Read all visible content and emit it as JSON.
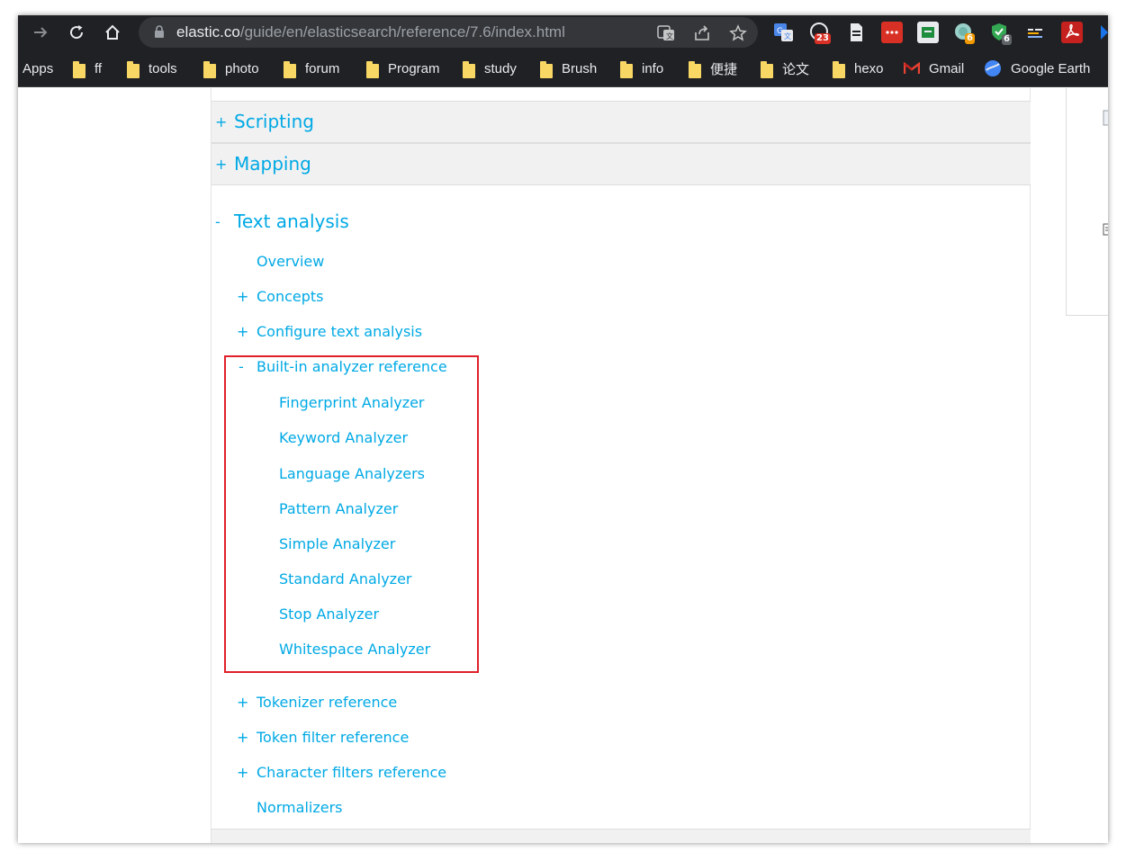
{
  "browser": {
    "url_host": "elastic.co",
    "url_path": "/guide/en/elasticsearch/reference/7.6/index.html",
    "badges": {
      "ext_timer": "23",
      "ext_globe": "6",
      "ext_shield": "6"
    }
  },
  "bookmarks": [
    {
      "label": "Apps"
    },
    {
      "label": "ff"
    },
    {
      "label": "tools"
    },
    {
      "label": "photo"
    },
    {
      "label": "forum"
    },
    {
      "label": "Program"
    },
    {
      "label": "study"
    },
    {
      "label": "Brush"
    },
    {
      "label": "info"
    },
    {
      "label": "便捷"
    },
    {
      "label": "论文"
    },
    {
      "label": "hexo"
    },
    {
      "label": "Gmail"
    },
    {
      "label": "Google Earth"
    }
  ],
  "nav": {
    "sections": [
      {
        "toggle": "+",
        "label": "Scripting"
      },
      {
        "toggle": "+",
        "label": "Mapping"
      },
      {
        "toggle": "-",
        "label": "Text analysis"
      }
    ],
    "text_analysis_items": [
      {
        "toggle": "",
        "label": "Overview"
      },
      {
        "toggle": "+",
        "label": "Concepts"
      },
      {
        "toggle": "+",
        "label": "Configure text analysis"
      },
      {
        "toggle": "-",
        "label": "Built-in analyzer reference"
      }
    ],
    "analyzers": [
      "Fingerprint Analyzer",
      "Keyword Analyzer",
      "Language Analyzers",
      "Pattern Analyzer",
      "Simple Analyzer",
      "Standard Analyzer",
      "Stop Analyzer",
      "Whitespace Analyzer"
    ],
    "more_items": [
      {
        "toggle": "+",
        "label": "Tokenizer reference"
      },
      {
        "toggle": "+",
        "label": "Token filter reference"
      },
      {
        "toggle": "+",
        "label": "Character filters reference"
      },
      {
        "toggle": "",
        "label": "Normalizers"
      }
    ]
  },
  "colors": {
    "link": "#00a9e5",
    "highlight_box": "#e0202a",
    "chrome": "#202124"
  }
}
